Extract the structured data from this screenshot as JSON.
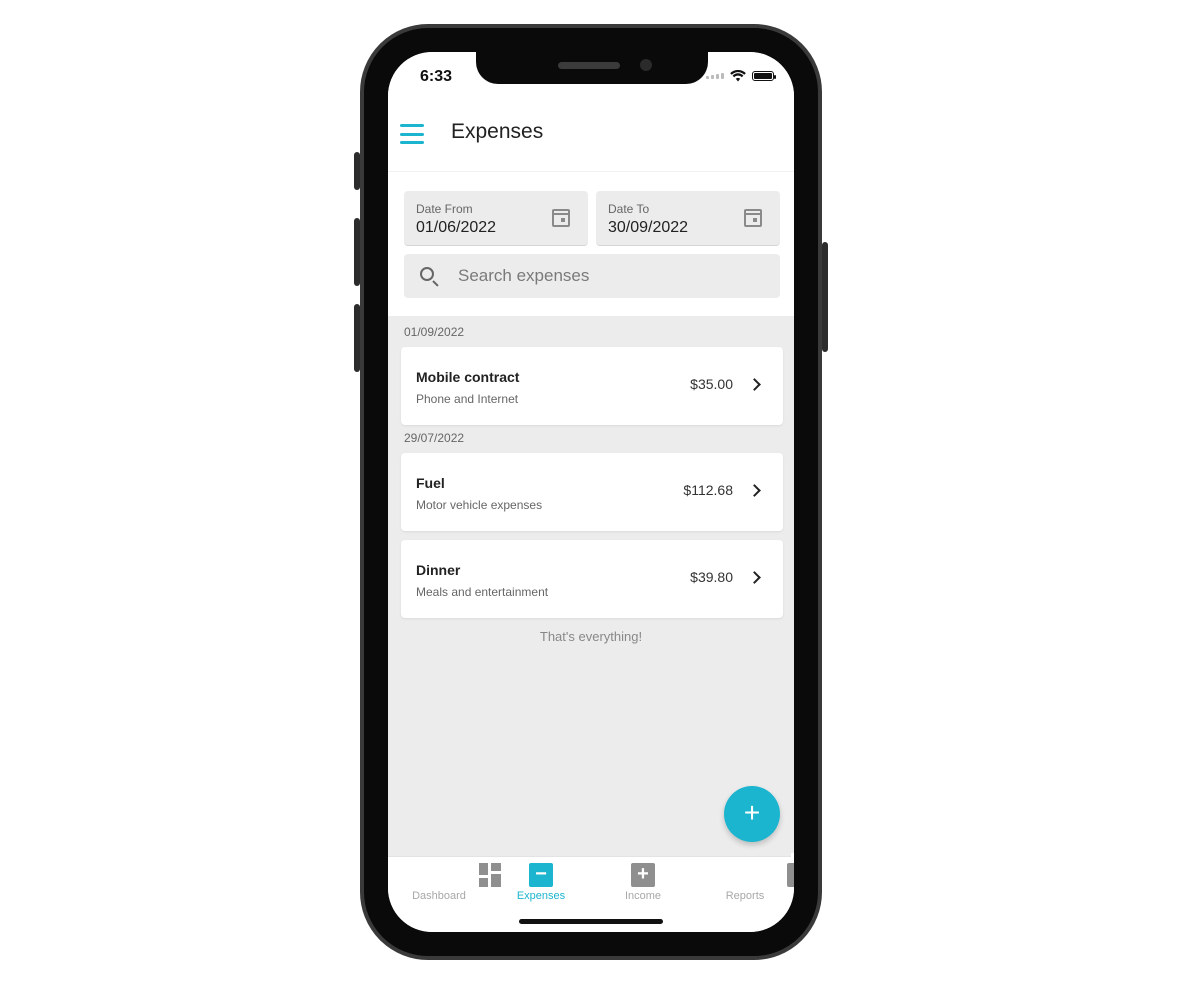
{
  "status_bar": {
    "time": "6:33"
  },
  "app_bar": {
    "title": "Expenses"
  },
  "filters": {
    "date_from": {
      "label": "Date From",
      "value": "01/06/2022"
    },
    "date_to": {
      "label": "Date To",
      "value": "30/09/2022"
    },
    "search": {
      "placeholder": "Search expenses",
      "value": ""
    }
  },
  "groups": [
    {
      "date": "01/09/2022",
      "items": [
        {
          "title": "Mobile contract",
          "category": "Phone and Internet",
          "amount": "$35.00"
        }
      ]
    },
    {
      "date": "29/07/2022",
      "items": [
        {
          "title": "Fuel",
          "category": "Motor vehicle expenses",
          "amount": "$112.68"
        },
        {
          "title": "Dinner",
          "category": "Meals and entertainment",
          "amount": "$39.80"
        }
      ]
    }
  ],
  "end_message": "That's everything!",
  "fab": {
    "label": "+",
    "icon": "plus-icon"
  },
  "tabs": [
    {
      "label": "Dashboard",
      "icon": "dashboard-icon",
      "active": false
    },
    {
      "label": "Expenses",
      "icon": "minus-box-icon",
      "active": true
    },
    {
      "label": "Income",
      "icon": "plus-box-icon",
      "active": false
    },
    {
      "label": "Reports",
      "icon": "report-icon",
      "active": false
    }
  ],
  "colors": {
    "accent": "#1cb5cf",
    "background": "#ececec",
    "surface": "#ffffff"
  }
}
